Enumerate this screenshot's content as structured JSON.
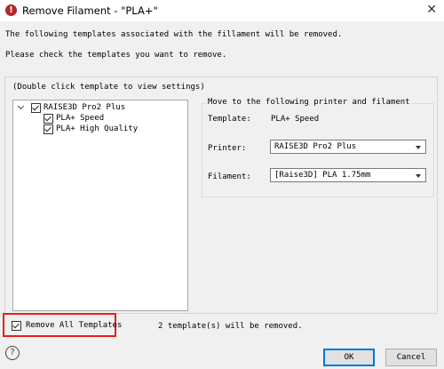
{
  "window": {
    "title": "Remove Filament - \"PLA+\"",
    "icon": "app-icon",
    "close_glyph": "✕"
  },
  "intro": {
    "line1": "The following templates associated with the fillament will be removed.",
    "line2": "Please check the templates you want to remove."
  },
  "tree_hint": "(Double click template to view settings)",
  "tree": {
    "root": {
      "label": "RAISE3D Pro2 Plus",
      "checked": true,
      "expanded": true
    },
    "children": [
      {
        "label": "PLA+ Speed",
        "checked": true
      },
      {
        "label": "PLA+ High Quality",
        "checked": true
      }
    ]
  },
  "move_group": {
    "title": "Move to the following printer and filament",
    "template_label": "Template:",
    "template_value": "PLA+ Speed",
    "printer_label": "Printer:",
    "printer_value": "RAISE3D Pro2 Plus",
    "filament_label": "Filament:",
    "filament_value": "[Raise3D] PLA 1.75mm"
  },
  "remove_all": {
    "label": "Remove All Templates",
    "checked": true
  },
  "status_text": "2 template(s) will be removed.",
  "buttons": {
    "ok": "OK",
    "cancel": "Cancel",
    "help": "?"
  },
  "colors": {
    "highlight": "#e3201f",
    "app_icon": "#b3262a",
    "default_button": "#0078d7"
  }
}
